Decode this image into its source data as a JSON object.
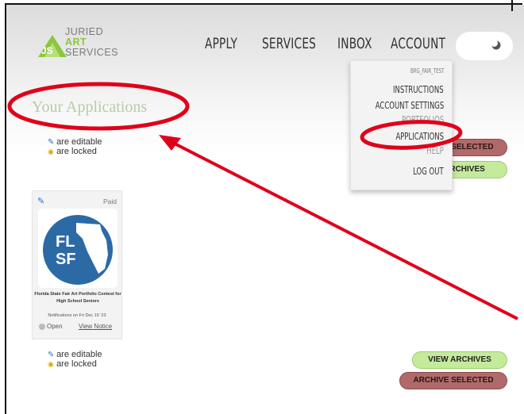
{
  "logo": {
    "line1": "JURIED",
    "line2": "ART",
    "line3": "SERVICES"
  },
  "nav": {
    "apply": "APPLY",
    "services": "SERVICES",
    "inbox": "INBOX",
    "account": "ACCOUNT"
  },
  "theme_toggle": {
    "icon": "moon-icon"
  },
  "account_menu": {
    "username": "BRG_FAIR_TEST",
    "items": [
      "INSTRUCTIONS",
      "ACCOUNT SETTINGS",
      "PORTFOLIOS",
      "APPLICATIONS",
      "HELP",
      "LOG OUT"
    ]
  },
  "page_title": "Your Applications",
  "legend": {
    "editable": "are editable",
    "locked": "are locked"
  },
  "buttons": {
    "archive_selected_top": "ARCHIVE SELECTED",
    "view_archives_top": "VIEW ARCHIVES",
    "view_archives_bottom": "VIEW ARCHIVES",
    "archive_selected_bottom": "ARCHIVE SELECTED"
  },
  "application_card": {
    "status_badge": "Paid",
    "logo_text": "FL SF",
    "title": "Florida State Fair Art Portfolio Contest for High School Seniors",
    "notification": "Notifications on Fri Dec 15 '23",
    "status": "Open",
    "notice_link": "View Notice"
  },
  "colors": {
    "green_button": "#c4ea9c",
    "red_button": "#b06a6a",
    "annotation_red": "#e0001a",
    "title_color": "#b9c9a9",
    "flsf_blue": "#2c6aa6"
  }
}
